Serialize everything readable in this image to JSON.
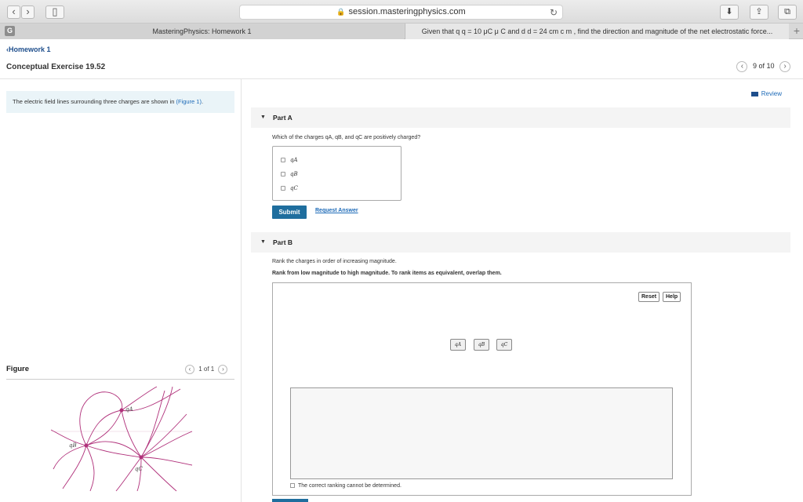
{
  "browser": {
    "url": "session.masteringphysics.com",
    "tabs": [
      {
        "label": "MasteringPhysics: Homework 1"
      },
      {
        "label": "Given that q q = 10 μC μ C and d d = 24 cm c m , find the direction and magnitude of the net electrostatic force..."
      }
    ],
    "tab_favicon": "G"
  },
  "page": {
    "back_label": "Homework 1",
    "title": "Conceptual Exercise 19.52",
    "pager_text": "9 of 10",
    "review_label": "Review"
  },
  "intro": {
    "text": "The electric field lines surrounding three charges are shown in",
    "link": "(Figure 1)",
    "suffix": "."
  },
  "figure": {
    "label": "Figure",
    "pager": "1 of 1",
    "charges": {
      "a": "qA",
      "b": "qB",
      "c": "qC"
    }
  },
  "partA": {
    "label": "Part A",
    "question": "Which of the charges qA, qB, and qC are positively charged?",
    "choices": [
      "qA",
      "qB",
      "qC"
    ],
    "submit_label": "Submit",
    "request_label": "Request Answer"
  },
  "partB": {
    "label": "Part B",
    "question": "Rank the charges in order of increasing magnitude.",
    "instruction": "Rank from low magnitude to high magnitude. To rank items as equivalent, overlap them.",
    "reset_label": "Reset",
    "help_label": "Help",
    "chips": [
      "qA",
      "qB",
      "qC"
    ],
    "equal_label": "The correct ranking cannot be determined."
  },
  "colors": {
    "accent": "#1f6e9e",
    "link": "#1e6bb8",
    "field_lines": "#b0307a"
  }
}
